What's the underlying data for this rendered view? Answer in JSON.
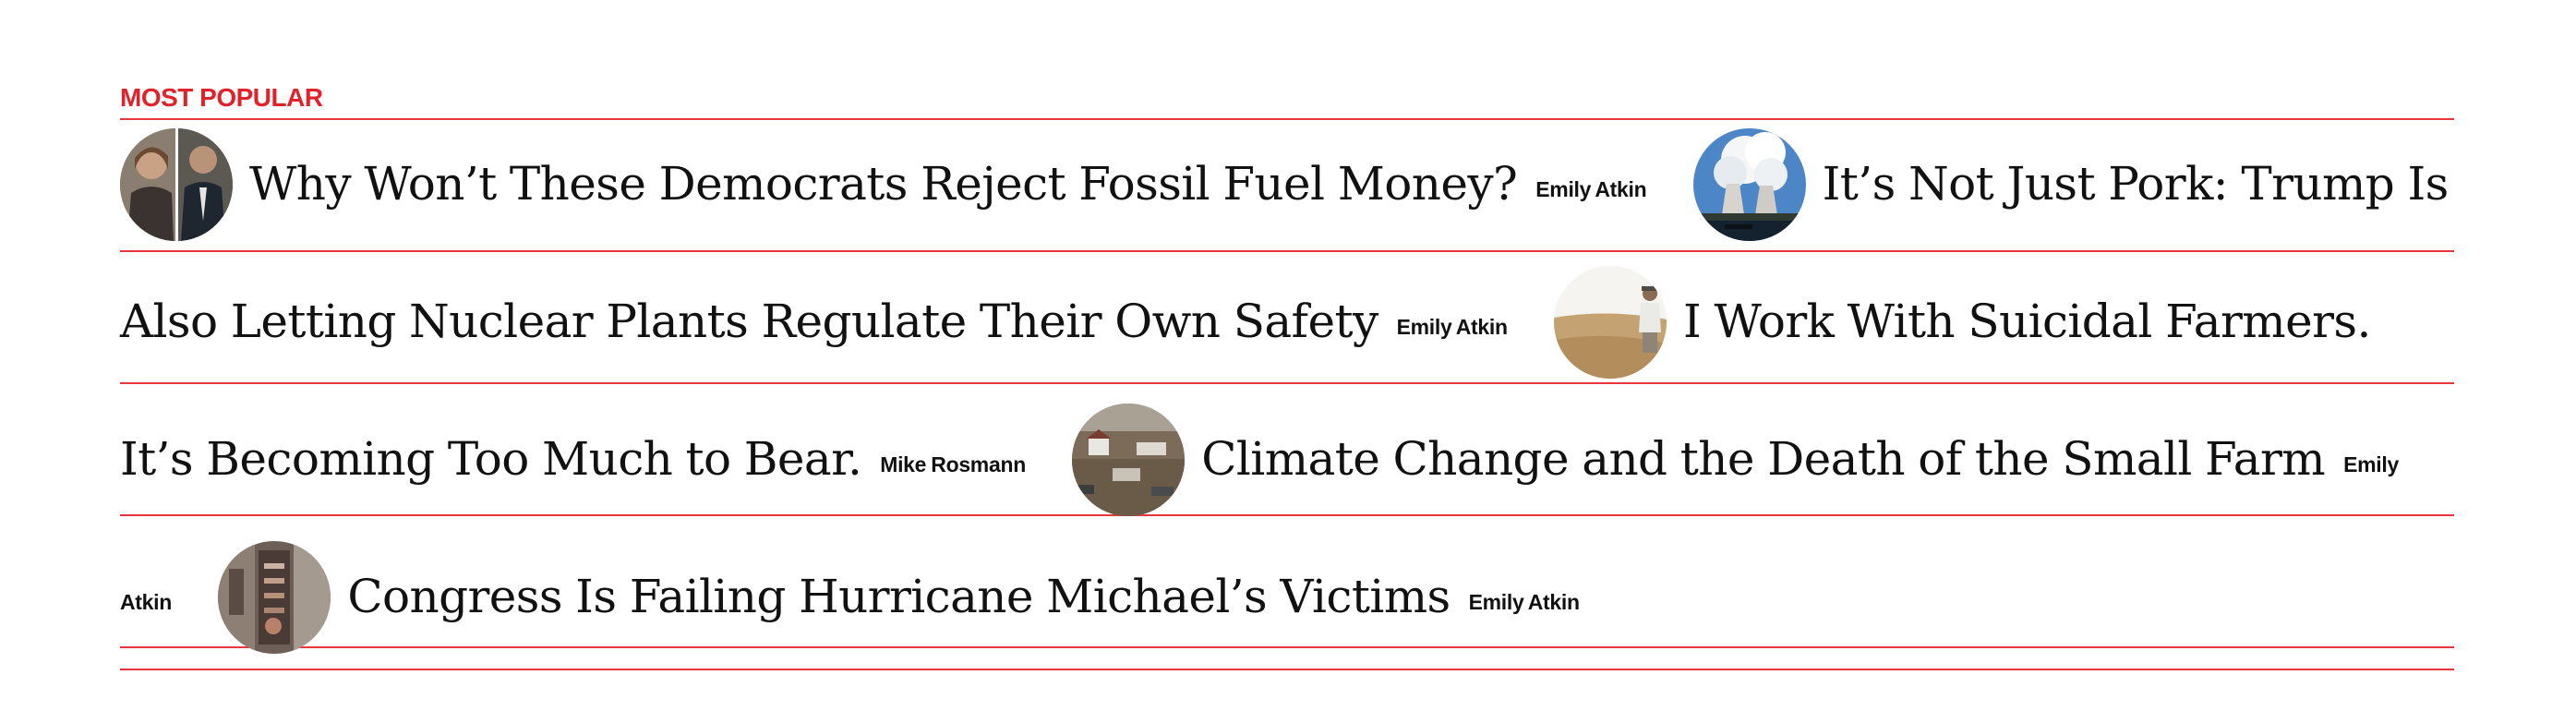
{
  "section_title": "MOST POPULAR",
  "stories": [
    {
      "headline": "Why Won’t These Democrats Reject Fossil Fuel Money?",
      "author": "Emily Atkin",
      "thumb_icon": "senators-photo-icon"
    },
    {
      "headline": "It’s Not Just Pork: Trump Is Also Letting Nuclear Plants Regulate Their Own Safety",
      "author": "Emily Atkin",
      "thumb_icon": "nuclear-plant-photo-icon"
    },
    {
      "headline": "I Work With Suicidal Farmers. It’s Becoming Too Much to Bear.",
      "author": "Mike Rosmann",
      "thumb_icon": "farmer-field-photo-icon"
    },
    {
      "headline": "Climate Change and the Death of the Small Farm",
      "author": "Emily Atkin",
      "thumb_icon": "flooded-farm-photo-icon"
    },
    {
      "headline": "Congress Is Failing Hurricane Michael’s Victims",
      "author": "Emily Atkin",
      "thumb_icon": "hurricane-damage-photo-icon"
    }
  ],
  "colors": {
    "accent": "#e0232b",
    "rule": "#e8363c",
    "text": "#111111"
  }
}
